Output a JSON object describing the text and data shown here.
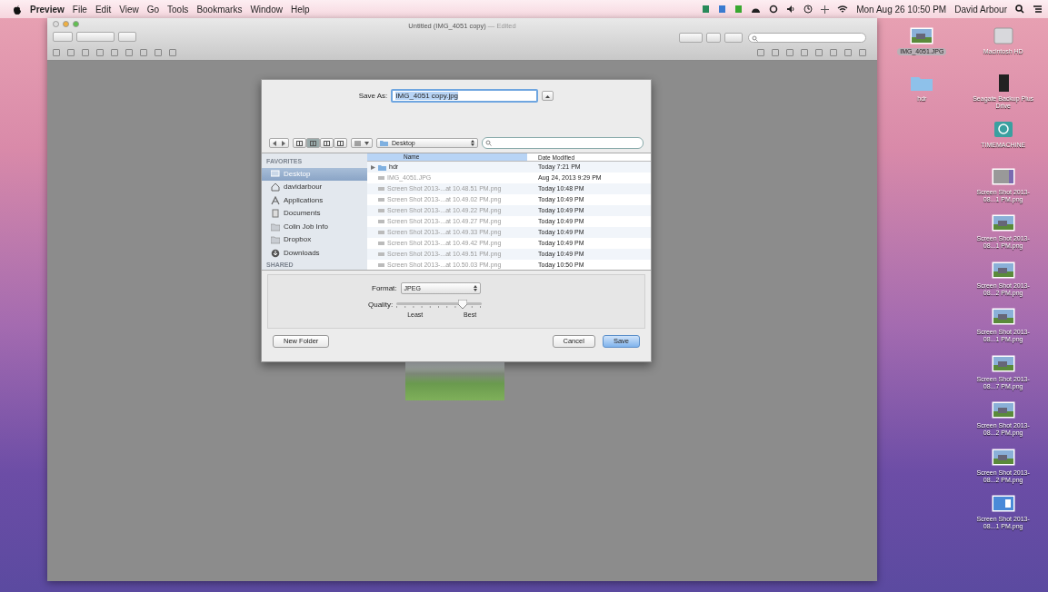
{
  "menu_bar": {
    "app": "Preview",
    "items": [
      "File",
      "Edit",
      "View",
      "Go",
      "Tools",
      "Bookmarks",
      "Window",
      "Help"
    ],
    "clock": "Mon Aug 26  10:50 PM",
    "user": "David Arbour"
  },
  "window": {
    "title": "Untitled (IMG_4051 copy)",
    "edited": "— Edited"
  },
  "save_dialog": {
    "save_as_label": "Save As:",
    "filename": "IMG_4051 copy.jpg",
    "location": "Desktop",
    "sidebar": {
      "heading": "FAVORITES",
      "next_heading": "SHARED",
      "items": [
        {
          "kind": "desktop",
          "label": "Desktop",
          "selected": true
        },
        {
          "kind": "home",
          "label": "davidarbour",
          "selected": false
        },
        {
          "kind": "apps",
          "label": "Applications",
          "selected": false
        },
        {
          "kind": "docs",
          "label": "Documents",
          "selected": false
        },
        {
          "kind": "folder",
          "label": "Colin Job Info",
          "selected": false
        },
        {
          "kind": "folder",
          "label": "Dropbox",
          "selected": false
        },
        {
          "kind": "downloads",
          "label": "Downloads",
          "selected": false
        }
      ]
    },
    "columns": [
      "Name",
      "Date Modified"
    ],
    "files": [
      {
        "kind": "folder",
        "name": "hdr",
        "date": "Today 7:21 PM",
        "disabled": false
      },
      {
        "kind": "file",
        "name": "IMG_4051.JPG",
        "date": "Aug 24, 2013 9:29 PM",
        "disabled": true
      },
      {
        "kind": "file",
        "name": "Screen Shot 2013-...at 10.48.51 PM.png",
        "date": "Today 10:48 PM",
        "disabled": true
      },
      {
        "kind": "file",
        "name": "Screen Shot 2013-...at 10.49.02 PM.png",
        "date": "Today 10:49 PM",
        "disabled": true
      },
      {
        "kind": "file",
        "name": "Screen Shot 2013-...at 10.49.22 PM.png",
        "date": "Today 10:49 PM",
        "disabled": true
      },
      {
        "kind": "file",
        "name": "Screen Shot 2013-...at 10.49.27 PM.png",
        "date": "Today 10:49 PM",
        "disabled": true
      },
      {
        "kind": "file",
        "name": "Screen Shot 2013-...at 10.49.33 PM.png",
        "date": "Today 10:49 PM",
        "disabled": true
      },
      {
        "kind": "file",
        "name": "Screen Shot 2013-...at 10.49.42 PM.png",
        "date": "Today 10:49 PM",
        "disabled": true
      },
      {
        "kind": "file",
        "name": "Screen Shot 2013-...at 10.49.51 PM.png",
        "date": "Today 10:49 PM",
        "disabled": true
      },
      {
        "kind": "file",
        "name": "Screen Shot 2013-...at 10.50.03 PM.png",
        "date": "Today 10:50 PM",
        "disabled": true
      }
    ],
    "format_label": "Format:",
    "format": "JPEG",
    "quality_label": "Quality:",
    "quality": {
      "level": 0.78
    },
    "least": "Least",
    "best": "Best",
    "buttons": [
      {
        "label": "New Folder",
        "default": false
      },
      {
        "label": "Cancel",
        "default": false
      },
      {
        "label": "Save",
        "default": true
      }
    ]
  },
  "desktop": [
    [
      {
        "kind": "photo",
        "label": "IMG_4051.JPG",
        "selected": true
      },
      {
        "kind": "folder",
        "label": "hdr",
        "selected": false
      }
    ],
    [
      {
        "kind": "disk",
        "label": "Macintosh HD",
        "selected": false
      },
      {
        "kind": "drive",
        "label": "Seagate Backup Plus Drive",
        "selected": false
      },
      {
        "kind": "timemachine",
        "label": "TIMEMACHINE",
        "selected": false
      },
      {
        "kind": "screenshot",
        "label": "Screen Shot 2013-08...1 PM.png",
        "selected": false
      },
      {
        "kind": "photo",
        "label": "Screen Shot 2013-08...1 PM.png",
        "selected": false
      },
      {
        "kind": "photo",
        "label": "Screen Shot 2013-08...2 PM.png",
        "selected": false
      },
      {
        "kind": "photo",
        "label": "Screen Shot 2013-08...1 PM.png",
        "selected": false
      },
      {
        "kind": "photo",
        "label": "Screen Shot 2013-08...7 PM.png",
        "selected": false
      },
      {
        "kind": "photo",
        "label": "Screen Shot 2013-08...2 PM.png",
        "selected": false
      },
      {
        "kind": "photo",
        "label": "Screen Shot 2013-08...2 PM.png",
        "selected": false
      },
      {
        "kind": "blue",
        "label": "Screen Shot 2013-08...1 PM.png",
        "selected": false
      }
    ]
  ]
}
